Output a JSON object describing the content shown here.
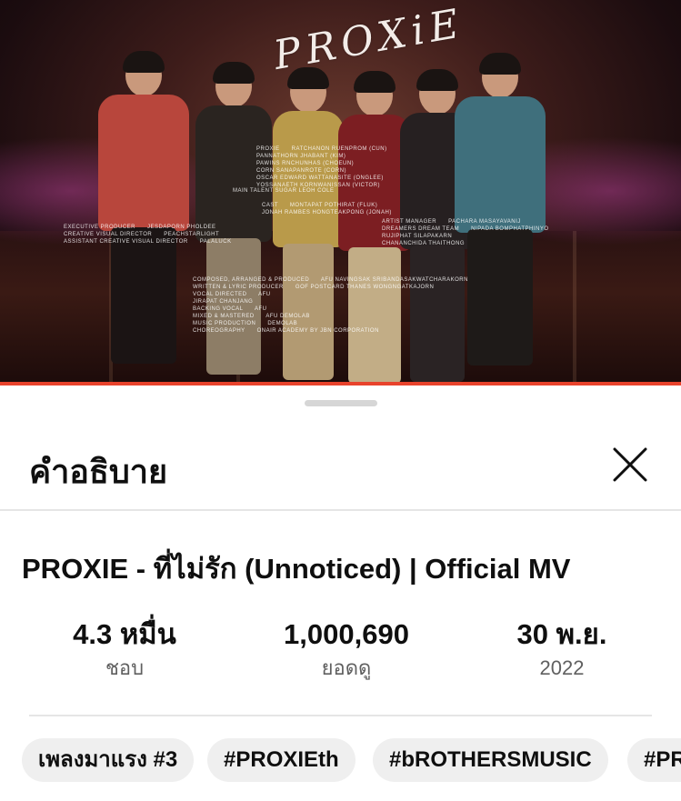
{
  "video": {
    "logo_text": "PROXiE",
    "credits": {
      "proxie": "PROXIE      RATCHANON RUENPROM (CUN)\nPANNATHORN JHABANT (KIM)\nPAWINS RNCHUNHAS (CHOEUN)\nCORN SANAPANROTE (CORN)\nOSCAR EDWARD WATTANASITE (ONGLEE)\nYOSSANAETH KORNWANISSAN (VICTOR)",
      "main_talent": "MAIN TALENT      SUGAR LEOH COLE",
      "cast": "CAST      MONTAPAT POTHIRAT (FLUK)\nJONAH RAMBES HONGTEAKPONG (JONAH)",
      "exec": "EXECUTIVE PRODUCER      JESDAPORN PHOLDEE\nCREATIVE VISUAL DIRECTOR      PEACHSTARLIGHT\nASSISTANT CREATIVE VISUAL DIRECTOR      PALALUCK",
      "artist": "ARTIST MANAGER      PACHARA MASAYAVANIJ\nDREAMERS DREAM TEAM      NIPADA BOMPHATPHINYO\nRUJIPHAT SILAPAKARN\nCHANANCHIDA THAITHONG",
      "music": "COMPOSED, ARRANGED & PRODUCED      AFU NAVINGSAK SRIBANDASAKWATCHARAKORN\nWRITTEN & LYRIC PRODUCER      GOF POSTCARD THANES WONGNGATKAJORN\nVOCAL DIRECTED      AFU\nJIRAPAT CHANJANG\nBACKING VOCAL      AFU\nMIXED & MASTERED      AFU DEMOLAB\nMUSIC PRODUCTION      DEMOLAB\nCHOREOGRAPHY      ONAIR ACADEMY BY JBN CORPORATION"
    },
    "progress_color": "#e8432c"
  },
  "sheet": {
    "title": "คำอธิบาย",
    "close_icon": "close-icon",
    "video_title": "PROXIE - ที่ไม่รัก (Unnoticed) | Official MV",
    "stats": [
      {
        "value": "4.3 หมื่น",
        "label": "ชอบ"
      },
      {
        "value": "1,000,690",
        "label": "ยอดดู"
      },
      {
        "value": "30 พ.ย.",
        "label": "2022"
      }
    ],
    "chips": [
      "เพลงมาแรง #3",
      "#PROXIEth",
      "#bROTHERSMUSIC",
      "#PR"
    ]
  }
}
